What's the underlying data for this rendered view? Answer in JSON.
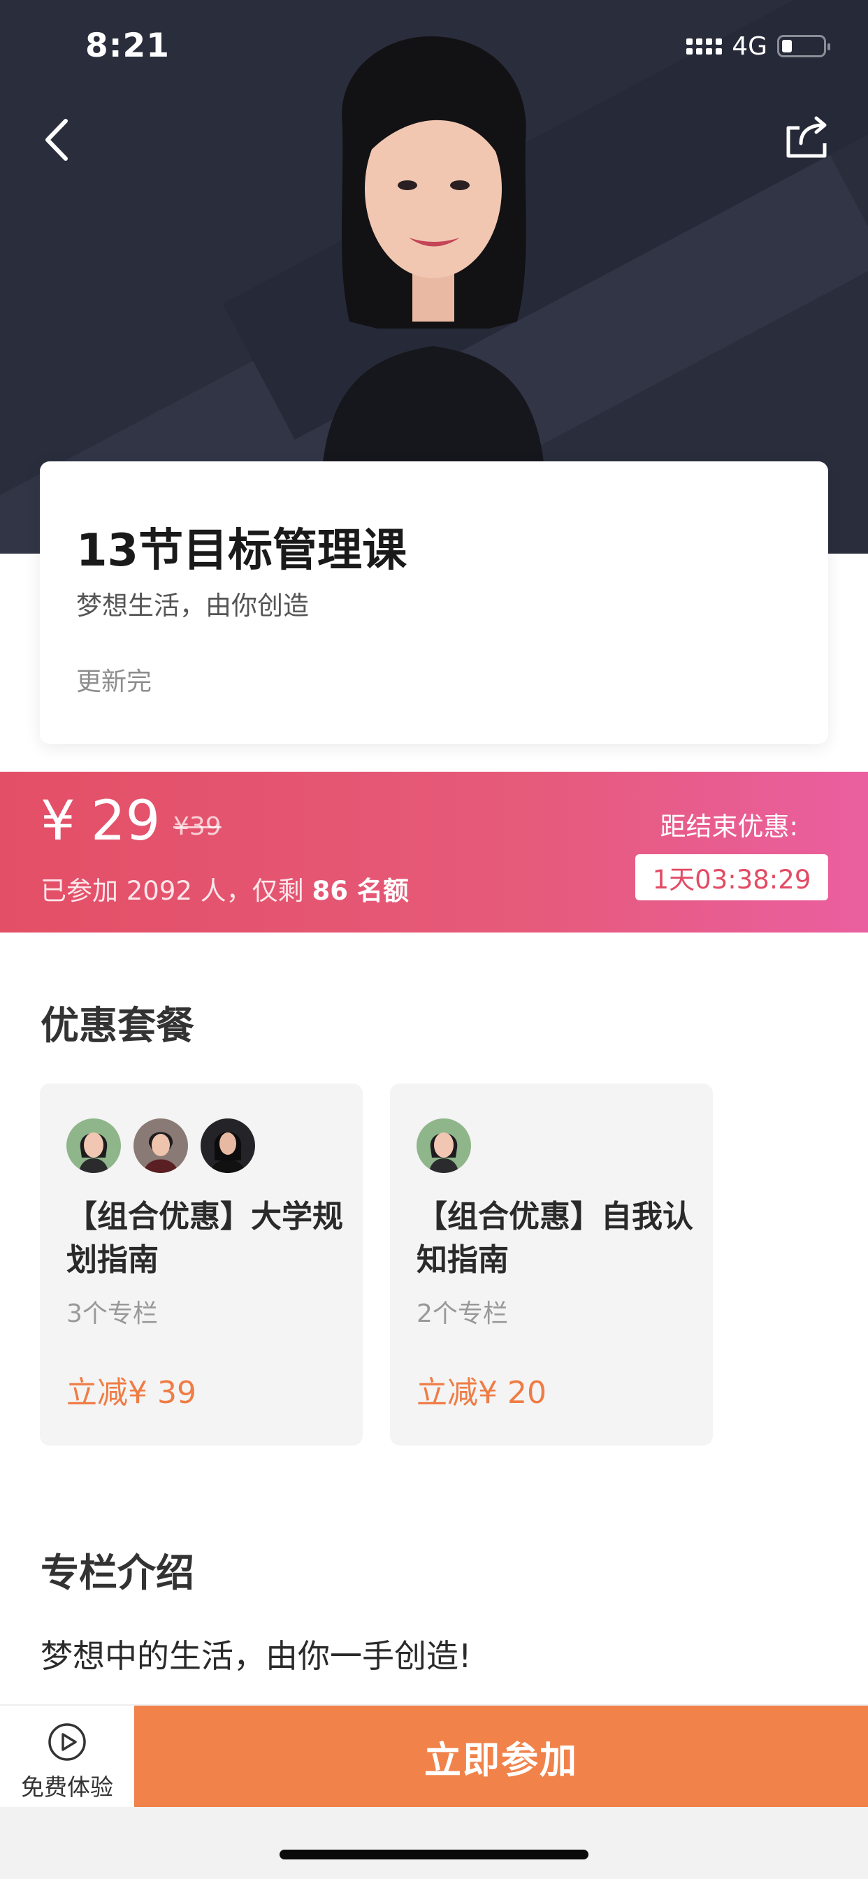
{
  "status_bar": {
    "time": "8:21",
    "network": "4G"
  },
  "nav": {
    "back_icon": "chevron-left-icon",
    "share_icon": "share-icon"
  },
  "course": {
    "title": "13节目标管理课",
    "subtitle": "梦想生活，由你创造",
    "status": "更新完"
  },
  "promo": {
    "currency": "¥",
    "price": "29",
    "original_price": "¥39",
    "joined_prefix": "已参加 2092 人，仅剩 ",
    "remaining": "86",
    "remaining_suffix": " 名额",
    "countdown_label": "距结束优惠:",
    "countdown": "1天03:38:29",
    "gradient": [
      "#e34f66",
      "#ea5f9f"
    ]
  },
  "packages": {
    "title": "优惠套餐",
    "items": [
      {
        "title": "【组合优惠】大学规划指南",
        "count": "3个专栏",
        "discount": "立减¥ 39",
        "avatars": [
          "instructor-avatar-1",
          "instructor-avatar-2",
          "instructor-avatar-3"
        ]
      },
      {
        "title": "【组合优惠】自我认知指南",
        "count": "2个专栏",
        "discount": "立减¥ 20",
        "avatars": [
          "instructor-avatar-1"
        ]
      }
    ]
  },
  "intro": {
    "title": "专栏介绍",
    "text": "梦想中的生活，由你一手创造!"
  },
  "bottom": {
    "trial_label": "免费体验",
    "trial_icon": "play-circle-icon",
    "join_label": "立即参加",
    "join_color": "#f0824a"
  }
}
